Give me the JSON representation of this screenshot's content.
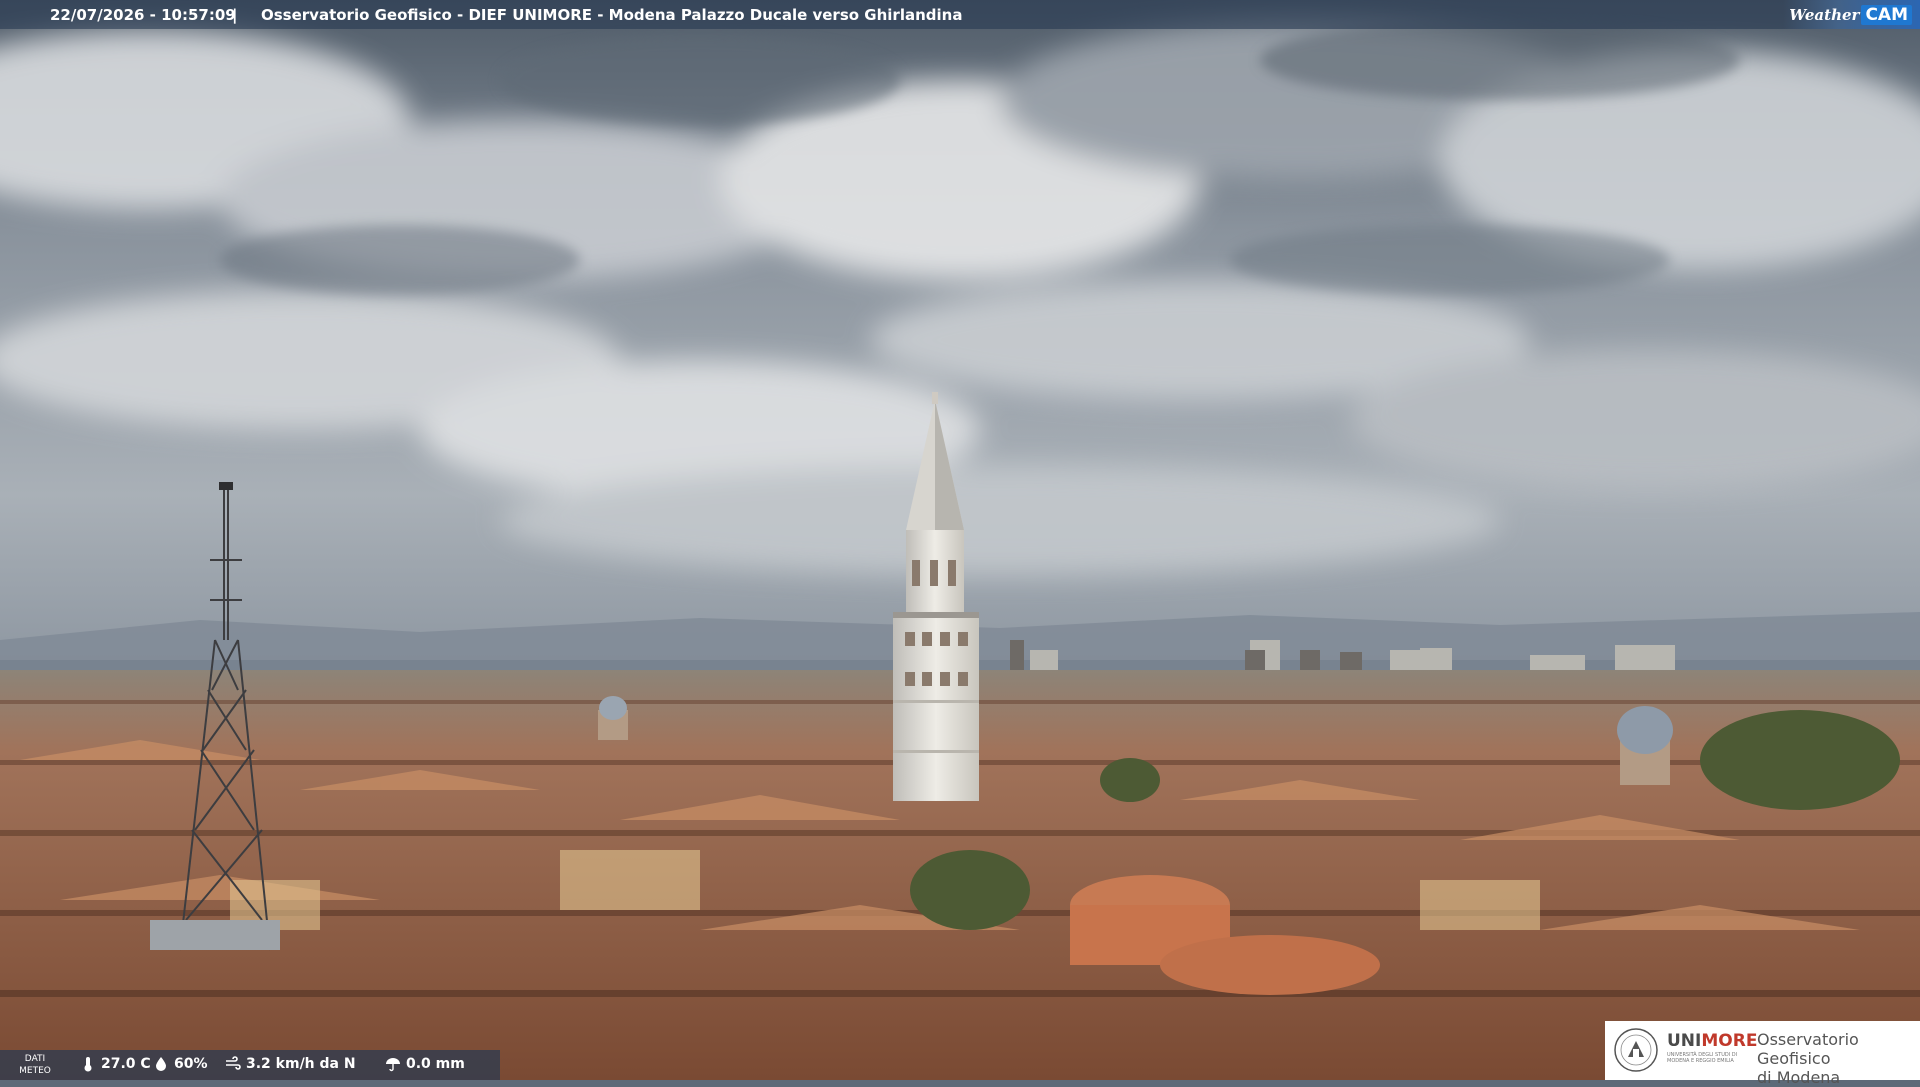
{
  "header": {
    "timestamp": "22/07/2026 - 10:57:09",
    "separator": "|",
    "title": "Osservatorio Geofisico - DIEF UNIMORE - Modena Palazzo Ducale verso Ghirlandina",
    "logo_text_1": "Weather",
    "logo_text_2": "CAM"
  },
  "weather": {
    "label_1": "DATI",
    "label_2": "METEO",
    "temperature": "27.0 C",
    "humidity": "60%",
    "wind": "3.2 km/h da N",
    "rain": "0.0 mm",
    "icons": [
      "thermometer-icon",
      "humidity-icon",
      "wind-icon",
      "rain-icon"
    ]
  },
  "logo": {
    "uni_prefix": "UNI",
    "uni_suffix": "MORE",
    "uni_subtitle": "UNIVERSITÀ DEGLI STUDI DI MODENA E REGGIO EMILIA",
    "obs_line1": "Osservatorio Geofisico",
    "obs_line2": "di Modena"
  },
  "colors": {
    "banner": "#283a52",
    "unimore_red": "#c0392b",
    "weathercam_blue": "#1f78d1"
  }
}
